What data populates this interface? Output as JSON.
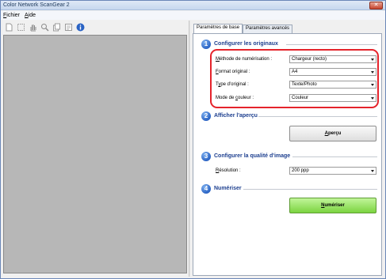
{
  "window": {
    "title": "Color Network ScanGear 2",
    "close_glyph": "✕"
  },
  "menu": [
    {
      "accel": "F",
      "rest": "ichier"
    },
    {
      "accel": "A",
      "rest": "ide"
    }
  ],
  "toolbar": {
    "icons": [
      "new-page-icon",
      "select-area-icon",
      "hand-pan-icon",
      "zoom-icon",
      "copy-icon",
      "multi-page-icon",
      "info-icon"
    ]
  },
  "tabs": [
    "Paramètres de base",
    "Paramètres avancés"
  ],
  "sections": {
    "s1": {
      "num": "1",
      "title": "Configurer les originaux"
    },
    "s2": {
      "num": "2",
      "title": "Afficher l'aperçu"
    },
    "s3": {
      "num": "3",
      "title": "Configurer la qualité d'image"
    },
    "s4": {
      "num": "4",
      "title": "Numériser"
    }
  },
  "originals": {
    "scan_method": {
      "accel": "M",
      "rest": "éthode de numérisation :",
      "value": "Chargeur (recto)"
    },
    "format": {
      "accel": "F",
      "rest": "ormat original :",
      "value": "A4"
    },
    "type": {
      "pre": "T",
      "accel": "y",
      "rest": "pe d'original :",
      "value": "Texte/Photo"
    },
    "color_mode": {
      "pre": "Mode de ",
      "accel": "c",
      "rest": "ouleur :",
      "value": "Couleur"
    }
  },
  "preview": {
    "accel": "A",
    "rest": "perçu"
  },
  "quality": {
    "resolution": {
      "accel": "R",
      "rest": "ésolution :",
      "value": "200 ppp"
    }
  },
  "scan": {
    "accel": "N",
    "rest": "umériser"
  },
  "colors": {
    "accent_blue": "#2a63c4",
    "highlight_red": "#e5232b",
    "scan_green": "#7bd441"
  }
}
